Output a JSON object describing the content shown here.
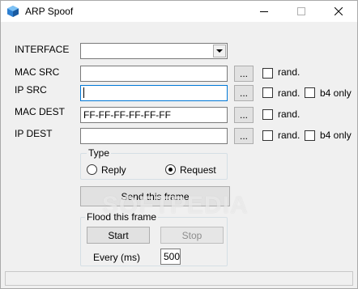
{
  "window": {
    "title": "ARP Spoof",
    "icon": "blue-cube-icon"
  },
  "titlebar_controls": {
    "minimize_icon": "minimize-icon",
    "maximize_icon": "maximize-icon",
    "close_icon": "close-icon"
  },
  "form": {
    "interface_label": "INTERFACE",
    "interface_value": "",
    "mac_src_label": "MAC SRC",
    "mac_src_value": "",
    "ip_src_label": "IP SRC",
    "ip_src_value": "",
    "mac_dest_label": "MAC DEST",
    "mac_dest_value": "FF-FF-FF-FF-FF-FF",
    "ip_dest_label": "IP DEST",
    "ip_dest_value": "",
    "browse_label": "...",
    "rand_label": "rand.",
    "b4only_label": "b4 only",
    "rand_checked": false,
    "b4only_checked": false
  },
  "type_group": {
    "title": "Type",
    "reply_label": "Reply",
    "request_label": "Request",
    "selected": "Request"
  },
  "send_button": "Send this frame",
  "flood_group": {
    "title": "Flood this frame",
    "start_label": "Start",
    "stop_label": "Stop",
    "every_label": "Every (ms)",
    "every_value": "500"
  },
  "watermark": "SOFTPEDIA",
  "status": ""
}
